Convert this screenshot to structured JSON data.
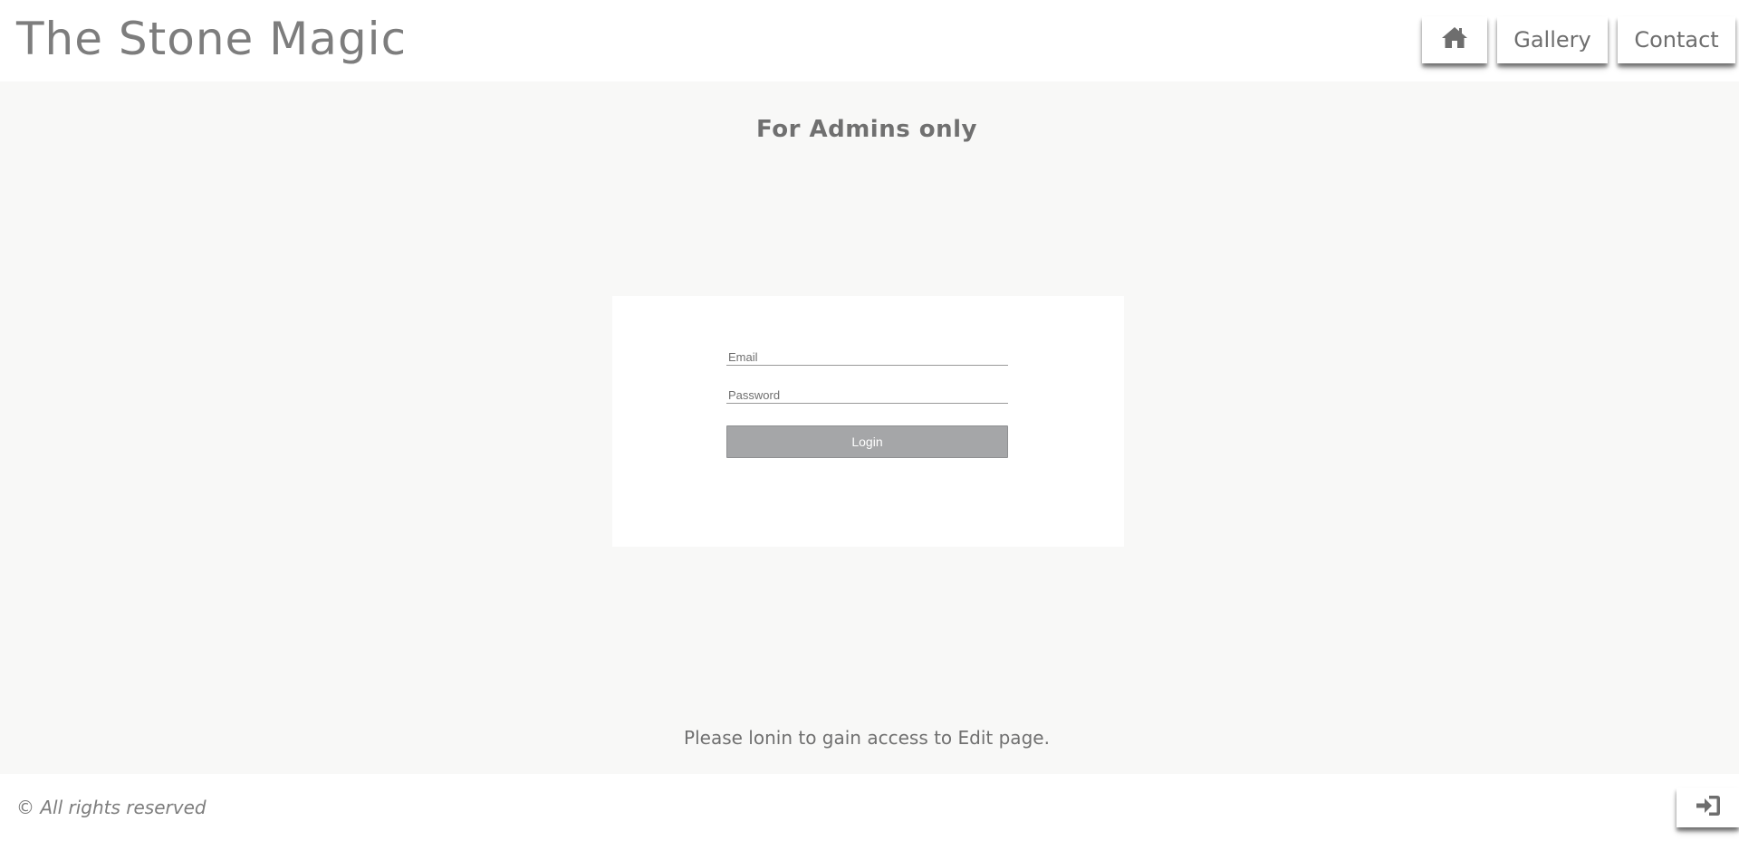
{
  "header": {
    "site_title": "The Stone Magic",
    "nav": {
      "home_icon": "home-icon",
      "gallery_label": "Gallery",
      "contact_label": "Contact"
    }
  },
  "main": {
    "subtitle": "For Admins only",
    "form": {
      "email_placeholder": "Email",
      "password_placeholder": "Password",
      "login_label": "Login"
    },
    "notice": "Please lonin to gain access to Edit page."
  },
  "footer": {
    "copyright": "© All rights reserved",
    "login_icon": "sign-in-icon"
  },
  "colors": {
    "text": "#7d7d7d",
    "background": "#f8f8f7",
    "button": "#a5a6a8"
  }
}
